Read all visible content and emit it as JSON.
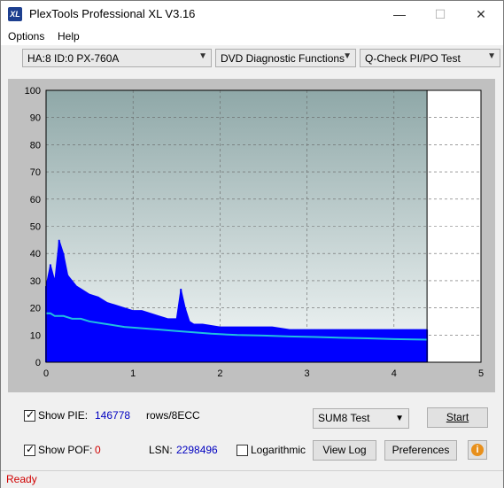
{
  "window": {
    "title": "PlexTools Professional XL V3.16",
    "logo_text": "XL",
    "controls": {
      "minimize": "—",
      "maximize": "☐",
      "close": "✕"
    }
  },
  "menu": {
    "options": "Options",
    "help": "Help"
  },
  "toolbar": {
    "drive": "HA:8 ID:0  PX-760A",
    "function": "DVD Diagnostic Functions",
    "test": "Q-Check PI/PO Test"
  },
  "chart_data": {
    "type": "area",
    "x_ticks": [
      "0",
      "1",
      "2",
      "3",
      "4",
      "5"
    ],
    "y_ticks": [
      "0",
      "10",
      "20",
      "30",
      "40",
      "50",
      "60",
      "70",
      "80",
      "90",
      "100"
    ],
    "xlim": [
      0,
      5
    ],
    "ylim": [
      0,
      100
    ],
    "grid": true,
    "scan_end_x": 4.38,
    "series": [
      {
        "type": "area",
        "color": "#0000ff",
        "x": [
          0,
          0.05,
          0.1,
          0.15,
          0.2,
          0.25,
          0.3,
          0.35,
          0.4,
          0.5,
          0.6,
          0.7,
          0.8,
          0.9,
          1.0,
          1.1,
          1.2,
          1.3,
          1.4,
          1.5,
          1.55,
          1.6,
          1.65,
          1.7,
          1.8,
          2.0,
          2.2,
          2.4,
          2.6,
          2.8,
          3.0,
          3.2,
          3.4,
          3.6,
          3.8,
          4.0,
          4.2,
          4.38
        ],
        "values": [
          28,
          36,
          30,
          45,
          40,
          32,
          30,
          28,
          27,
          25,
          24,
          22,
          21,
          20,
          19,
          19,
          18,
          17,
          16,
          16,
          27,
          20,
          15,
          14,
          14,
          13,
          13,
          13,
          13,
          12,
          12,
          12,
          12,
          12,
          12,
          12,
          12,
          12
        ]
      },
      {
        "type": "line",
        "color": "#20c0e0",
        "x": [
          0,
          0.05,
          0.1,
          0.2,
          0.3,
          0.4,
          0.5,
          0.7,
          0.9,
          1.1,
          1.3,
          1.5,
          1.7,
          1.9,
          2.2,
          2.5,
          2.8,
          3.1,
          3.4,
          3.7,
          4.0,
          4.38
        ],
        "values": [
          18,
          18,
          17,
          17,
          16,
          16,
          15,
          14,
          13,
          12.5,
          12,
          11.5,
          11,
          10.5,
          10,
          9.8,
          9.5,
          9.3,
          9,
          8.8,
          8.5,
          8.3
        ]
      }
    ]
  },
  "controls": {
    "show_pie_label": "Show PIE:",
    "pie_value": "146778",
    "rows_label": "rows/8ECC",
    "show_pof_label": "Show POF:",
    "pof_value": "0",
    "lsn_label": "LSN:",
    "lsn_value": "2298496",
    "log_label": "Logarithmic",
    "sum_select": "SUM8 Test",
    "start_btn": "Start",
    "viewlog_btn": "View Log",
    "prefs_btn": "Preferences",
    "info_glyph": "i"
  },
  "status": {
    "text": "Ready"
  }
}
